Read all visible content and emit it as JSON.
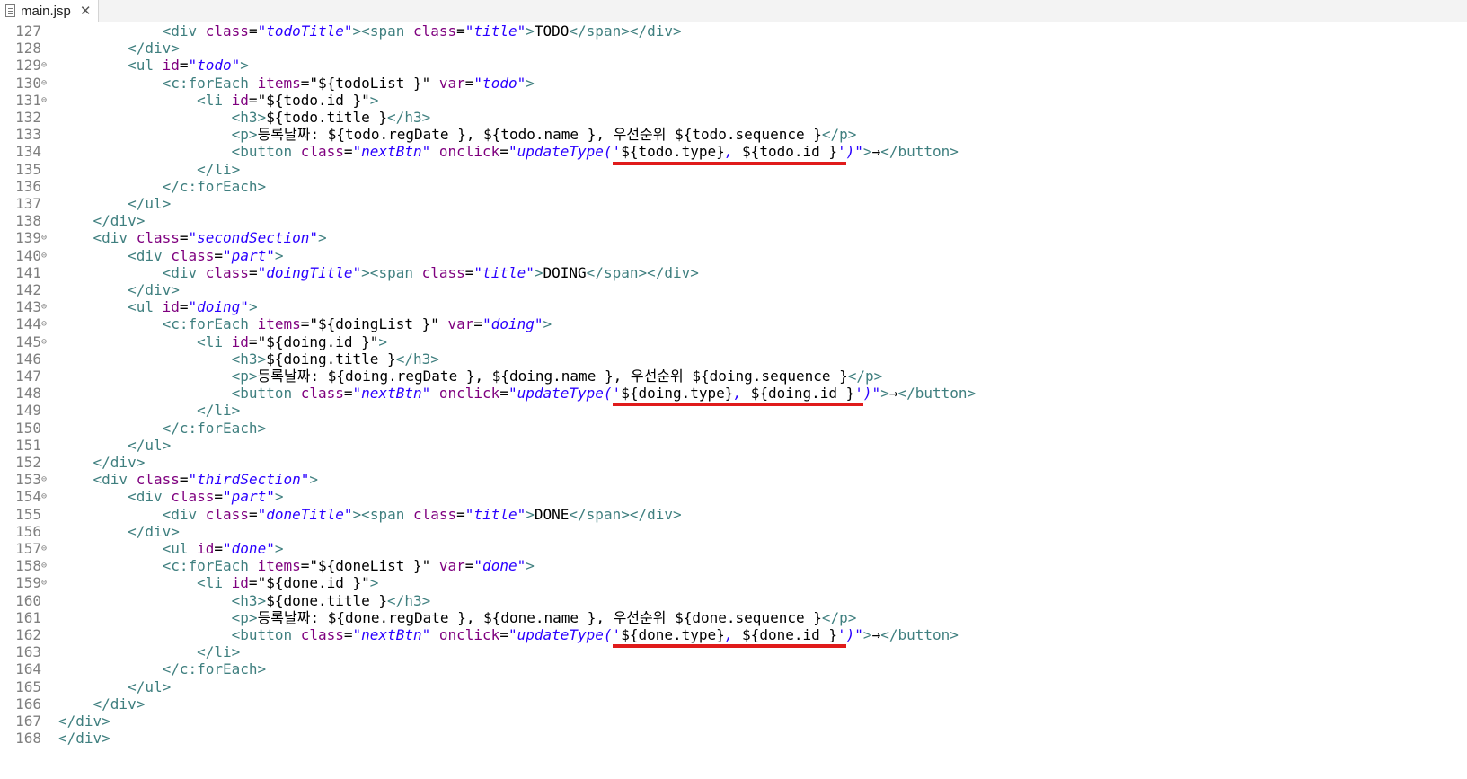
{
  "tab": {
    "title": "main.jsp",
    "close": "✕"
  },
  "lines": [
    {
      "n": "127",
      "fold": "",
      "indent": "            ",
      "segs": [
        [
          "t",
          "<div "
        ],
        [
          "a",
          "class"
        ],
        [
          "x",
          "="
        ],
        [
          "v",
          "\"todoTitle\""
        ],
        [
          "t",
          "><span "
        ],
        [
          "a",
          "class"
        ],
        [
          "x",
          "="
        ],
        [
          "v",
          "\"title\""
        ],
        [
          "t",
          ">"
        ],
        [
          "x",
          "TODO"
        ],
        [
          "t",
          "</span></div>"
        ]
      ]
    },
    {
      "n": "128",
      "fold": "",
      "indent": "        ",
      "segs": [
        [
          "t",
          "</div>"
        ]
      ]
    },
    {
      "n": "129",
      "fold": "⊖",
      "indent": "        ",
      "segs": [
        [
          "t",
          "<ul "
        ],
        [
          "a",
          "id"
        ],
        [
          "x",
          "="
        ],
        [
          "v",
          "\"todo\""
        ],
        [
          "t",
          ">"
        ]
      ]
    },
    {
      "n": "130",
      "fold": "⊖",
      "indent": "            ",
      "segs": [
        [
          "t",
          "<c:forEach "
        ],
        [
          "a",
          "items"
        ],
        [
          "x",
          "="
        ],
        [
          "x",
          "\"${todoList }\""
        ],
        [
          "t",
          " "
        ],
        [
          "a",
          "var"
        ],
        [
          "x",
          "="
        ],
        [
          "v",
          "\"todo\""
        ],
        [
          "t",
          ">"
        ]
      ]
    },
    {
      "n": "131",
      "fold": "⊖",
      "indent": "                ",
      "segs": [
        [
          "t",
          "<li "
        ],
        [
          "a",
          "id"
        ],
        [
          "x",
          "="
        ],
        [
          "x",
          "\"${todo.id }\""
        ],
        [
          "t",
          ">"
        ]
      ]
    },
    {
      "n": "132",
      "fold": "",
      "indent": "                    ",
      "segs": [
        [
          "t",
          "<h3>"
        ],
        [
          "x",
          "${todo.title }"
        ],
        [
          "t",
          "</h3>"
        ]
      ]
    },
    {
      "n": "133",
      "fold": "",
      "indent": "                    ",
      "segs": [
        [
          "t",
          "<p>"
        ],
        [
          "x",
          "등록날짜: ${todo.regDate }, ${todo.name }, 우선순위 ${todo.sequence }"
        ],
        [
          "t",
          "</p>"
        ]
      ]
    },
    {
      "n": "134",
      "fold": "",
      "indent": "                    ",
      "segs": [
        [
          "t",
          "<button "
        ],
        [
          "a",
          "class"
        ],
        [
          "x",
          "="
        ],
        [
          "v",
          "\"nextBtn\""
        ],
        [
          "t",
          " "
        ],
        [
          "a",
          "onclick"
        ],
        [
          "x",
          "="
        ],
        [
          "v",
          "\"updateType('"
        ],
        [
          "x",
          "${todo.type}"
        ],
        [
          "v",
          ", "
        ],
        [
          "x",
          "${todo.id }"
        ],
        [
          "v",
          "')\""
        ],
        [
          "t",
          ">"
        ],
        [
          "x",
          "→"
        ],
        [
          "t",
          "</button>"
        ]
      ]
    },
    {
      "n": "135",
      "fold": "",
      "indent": "                ",
      "segs": [
        [
          "t",
          "</li>"
        ]
      ]
    },
    {
      "n": "136",
      "fold": "",
      "indent": "            ",
      "segs": [
        [
          "t",
          "</c:forEach>"
        ]
      ]
    },
    {
      "n": "137",
      "fold": "",
      "indent": "        ",
      "segs": [
        [
          "t",
          "</ul>"
        ]
      ]
    },
    {
      "n": "138",
      "fold": "",
      "indent": "    ",
      "segs": [
        [
          "t",
          "</div>"
        ]
      ]
    },
    {
      "n": "139",
      "fold": "⊖",
      "indent": "    ",
      "segs": [
        [
          "t",
          "<div "
        ],
        [
          "a",
          "class"
        ],
        [
          "x",
          "="
        ],
        [
          "v",
          "\"secondSection\""
        ],
        [
          "t",
          ">"
        ]
      ]
    },
    {
      "n": "140",
      "fold": "⊖",
      "indent": "        ",
      "segs": [
        [
          "t",
          "<div "
        ],
        [
          "a",
          "class"
        ],
        [
          "x",
          "="
        ],
        [
          "v",
          "\"part\""
        ],
        [
          "t",
          ">"
        ]
      ]
    },
    {
      "n": "141",
      "fold": "",
      "indent": "            ",
      "segs": [
        [
          "t",
          "<div "
        ],
        [
          "a",
          "class"
        ],
        [
          "x",
          "="
        ],
        [
          "v",
          "\"doingTitle\""
        ],
        [
          "t",
          "><span "
        ],
        [
          "a",
          "class"
        ],
        [
          "x",
          "="
        ],
        [
          "v",
          "\"title\""
        ],
        [
          "t",
          ">"
        ],
        [
          "x",
          "DOING"
        ],
        [
          "t",
          "</span></div>"
        ]
      ]
    },
    {
      "n": "142",
      "fold": "",
      "indent": "        ",
      "segs": [
        [
          "t",
          "</div>"
        ]
      ]
    },
    {
      "n": "143",
      "fold": "⊖",
      "indent": "        ",
      "segs": [
        [
          "t",
          "<ul "
        ],
        [
          "a",
          "id"
        ],
        [
          "x",
          "="
        ],
        [
          "v",
          "\"doing\""
        ],
        [
          "t",
          ">"
        ]
      ]
    },
    {
      "n": "144",
      "fold": "⊖",
      "indent": "            ",
      "segs": [
        [
          "t",
          "<c:forEach "
        ],
        [
          "a",
          "items"
        ],
        [
          "x",
          "="
        ],
        [
          "x",
          "\"${doingList }\""
        ],
        [
          "t",
          " "
        ],
        [
          "a",
          "var"
        ],
        [
          "x",
          "="
        ],
        [
          "v",
          "\"doing\""
        ],
        [
          "t",
          ">"
        ]
      ]
    },
    {
      "n": "145",
      "fold": "⊖",
      "indent": "                ",
      "segs": [
        [
          "t",
          "<li "
        ],
        [
          "a",
          "id"
        ],
        [
          "x",
          "="
        ],
        [
          "x",
          "\"${doing.id }\""
        ],
        [
          "t",
          ">"
        ]
      ]
    },
    {
      "n": "146",
      "fold": "",
      "indent": "                    ",
      "segs": [
        [
          "t",
          "<h3>"
        ],
        [
          "x",
          "${doing.title }"
        ],
        [
          "t",
          "</h3>"
        ]
      ]
    },
    {
      "n": "147",
      "fold": "",
      "indent": "                    ",
      "segs": [
        [
          "t",
          "<p>"
        ],
        [
          "x",
          "등록날짜: ${doing.regDate }, ${doing.name }, 우선순위 ${doing.sequence }"
        ],
        [
          "t",
          "</p>"
        ]
      ]
    },
    {
      "n": "148",
      "fold": "",
      "indent": "                    ",
      "segs": [
        [
          "t",
          "<button "
        ],
        [
          "a",
          "class"
        ],
        [
          "x",
          "="
        ],
        [
          "v",
          "\"nextBtn\""
        ],
        [
          "t",
          " "
        ],
        [
          "a",
          "onclick"
        ],
        [
          "x",
          "="
        ],
        [
          "v",
          "\"updateType('"
        ],
        [
          "x",
          "${doing.type}"
        ],
        [
          "v",
          ", "
        ],
        [
          "x",
          "${doing.id }"
        ],
        [
          "v",
          "')\""
        ],
        [
          "t",
          ">"
        ],
        [
          "x",
          "→"
        ],
        [
          "t",
          "</button>"
        ]
      ]
    },
    {
      "n": "149",
      "fold": "",
      "indent": "                ",
      "segs": [
        [
          "t",
          "</li>"
        ]
      ]
    },
    {
      "n": "150",
      "fold": "",
      "indent": "            ",
      "segs": [
        [
          "t",
          "</c:forEach>"
        ]
      ]
    },
    {
      "n": "151",
      "fold": "",
      "indent": "        ",
      "segs": [
        [
          "t",
          "</ul>"
        ]
      ]
    },
    {
      "n": "152",
      "fold": "",
      "indent": "    ",
      "segs": [
        [
          "t",
          "</div>"
        ]
      ]
    },
    {
      "n": "153",
      "fold": "⊖",
      "indent": "    ",
      "segs": [
        [
          "t",
          "<div "
        ],
        [
          "a",
          "class"
        ],
        [
          "x",
          "="
        ],
        [
          "v",
          "\"thirdSection\""
        ],
        [
          "t",
          ">"
        ]
      ]
    },
    {
      "n": "154",
      "fold": "⊖",
      "indent": "        ",
      "segs": [
        [
          "t",
          "<div "
        ],
        [
          "a",
          "class"
        ],
        [
          "x",
          "="
        ],
        [
          "v",
          "\"part\""
        ],
        [
          "t",
          ">"
        ]
      ]
    },
    {
      "n": "155",
      "fold": "",
      "indent": "            ",
      "segs": [
        [
          "t",
          "<div "
        ],
        [
          "a",
          "class"
        ],
        [
          "x",
          "="
        ],
        [
          "v",
          "\"doneTitle\""
        ],
        [
          "t",
          "><span "
        ],
        [
          "a",
          "class"
        ],
        [
          "x",
          "="
        ],
        [
          "v",
          "\"title\""
        ],
        [
          "t",
          ">"
        ],
        [
          "x",
          "DONE"
        ],
        [
          "t",
          "</span></div>"
        ]
      ]
    },
    {
      "n": "156",
      "fold": "",
      "indent": "        ",
      "segs": [
        [
          "t",
          "</div>"
        ]
      ]
    },
    {
      "n": "157",
      "fold": "⊖",
      "indent": "            ",
      "segs": [
        [
          "t",
          "<ul "
        ],
        [
          "a",
          "id"
        ],
        [
          "x",
          "="
        ],
        [
          "v",
          "\"done\""
        ],
        [
          "t",
          ">"
        ]
      ]
    },
    {
      "n": "158",
      "fold": "⊖",
      "indent": "            ",
      "segs": [
        [
          "t",
          "<c:forEach "
        ],
        [
          "a",
          "items"
        ],
        [
          "x",
          "="
        ],
        [
          "x",
          "\"${doneList }\""
        ],
        [
          "t",
          " "
        ],
        [
          "a",
          "var"
        ],
        [
          "x",
          "="
        ],
        [
          "v",
          "\"done\""
        ],
        [
          "t",
          ">"
        ]
      ]
    },
    {
      "n": "159",
      "fold": "⊖",
      "indent": "                ",
      "segs": [
        [
          "t",
          "<li "
        ],
        [
          "a",
          "id"
        ],
        [
          "x",
          "="
        ],
        [
          "x",
          "\"${done.id }\""
        ],
        [
          "t",
          ">"
        ]
      ]
    },
    {
      "n": "160",
      "fold": "",
      "indent": "                    ",
      "segs": [
        [
          "t",
          "<h3>"
        ],
        [
          "x",
          "${done.title }"
        ],
        [
          "t",
          "</h3>"
        ]
      ]
    },
    {
      "n": "161",
      "fold": "",
      "indent": "                    ",
      "segs": [
        [
          "t",
          "<p>"
        ],
        [
          "x",
          "등록날짜: ${done.regDate }, ${done.name }, 우선순위 ${done.sequence }"
        ],
        [
          "t",
          "</p>"
        ]
      ]
    },
    {
      "n": "162",
      "fold": "",
      "indent": "                    ",
      "segs": [
        [
          "t",
          "<button "
        ],
        [
          "a",
          "class"
        ],
        [
          "x",
          "="
        ],
        [
          "v",
          "\"nextBtn\""
        ],
        [
          "t",
          " "
        ],
        [
          "a",
          "onclick"
        ],
        [
          "x",
          "="
        ],
        [
          "v",
          "\"updateType('"
        ],
        [
          "x",
          "${done.type}"
        ],
        [
          "v",
          ", "
        ],
        [
          "x",
          "${done.id }"
        ],
        [
          "v",
          "')\""
        ],
        [
          "t",
          ">"
        ],
        [
          "x",
          "→"
        ],
        [
          "t",
          "</button>"
        ]
      ]
    },
    {
      "n": "163",
      "fold": "",
      "indent": "                ",
      "segs": [
        [
          "t",
          "</li>"
        ]
      ]
    },
    {
      "n": "164",
      "fold": "",
      "indent": "            ",
      "segs": [
        [
          "t",
          "</c:forEach>"
        ]
      ]
    },
    {
      "n": "165",
      "fold": "",
      "indent": "        ",
      "segs": [
        [
          "t",
          "</ul>"
        ]
      ]
    },
    {
      "n": "166",
      "fold": "",
      "indent": "    ",
      "segs": [
        [
          "t",
          "</div>"
        ]
      ]
    },
    {
      "n": "167",
      "fold": "",
      "indent": "",
      "segs": [
        [
          "t",
          "</div>"
        ]
      ]
    },
    {
      "n": "168",
      "fold": "",
      "indent": "",
      "segs": [
        [
          "t",
          "</div>"
        ]
      ]
    }
  ],
  "highlights": [
    "134",
    "148",
    "162"
  ],
  "colors": {
    "tag": "#3f7f7f",
    "attr": "#7f007f",
    "value": "#2a00ff",
    "text": "#000000",
    "underline": "#e01b1b"
  }
}
